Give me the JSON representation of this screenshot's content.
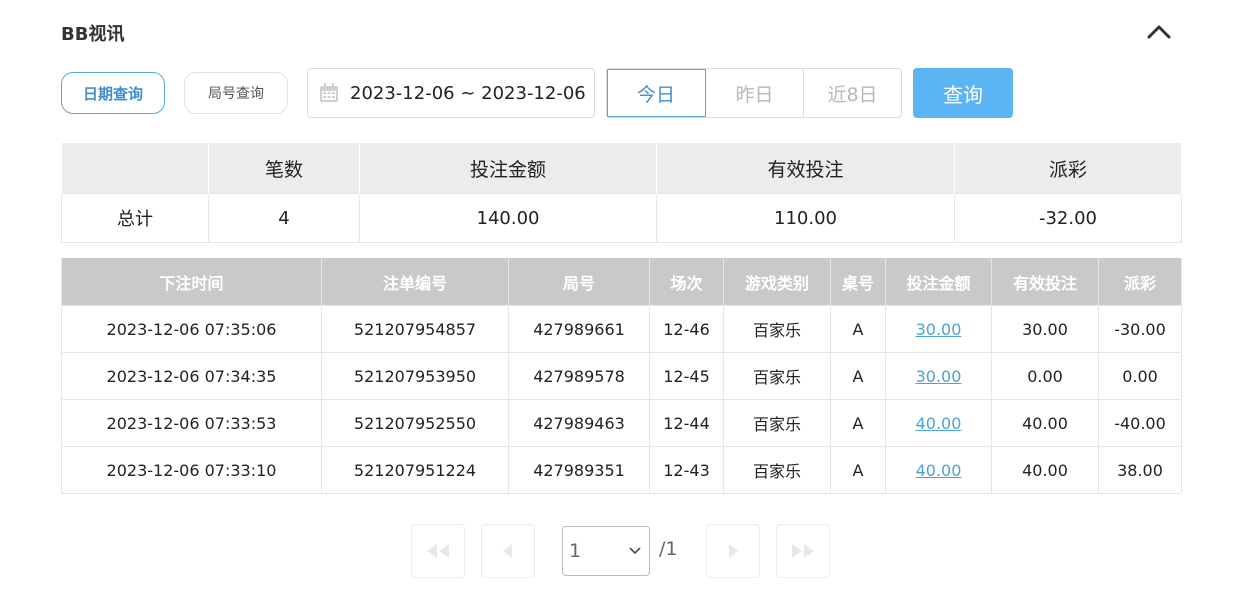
{
  "header": {
    "title": "BB视讯"
  },
  "query_modes": {
    "date_query": "日期查询",
    "game_query": "局号查询"
  },
  "date_range": {
    "value": "2023-12-06 ~ 2023-12-06"
  },
  "quick_ranges": [
    {
      "label": "今日",
      "active": true
    },
    {
      "label": "昨日",
      "active": false
    },
    {
      "label": "近8日",
      "active": false
    }
  ],
  "query_button": "查询",
  "summary": {
    "headers": [
      "",
      "笔数",
      "投注金额",
      "有效投注",
      "派彩"
    ],
    "row": {
      "label": "总计",
      "count": "4",
      "bet_amount": "140.00",
      "valid_bet": "110.00",
      "payout": "-32.00"
    }
  },
  "detail": {
    "headers": [
      "下注时间",
      "注单编号",
      "局号",
      "场次",
      "游戏类别",
      "桌号",
      "投注金额",
      "有效投注",
      "派彩"
    ],
    "rows": [
      {
        "time": "2023-12-06 07:35:06",
        "bet_id": "521207954857",
        "round_id": "427989661",
        "session": "12-46",
        "game_type": "百家乐",
        "table": "A",
        "bet_amount": "30.00",
        "valid_bet": "30.00",
        "payout": "-30.00"
      },
      {
        "time": "2023-12-06 07:34:35",
        "bet_id": "521207953950",
        "round_id": "427989578",
        "session": "12-45",
        "game_type": "百家乐",
        "table": "A",
        "bet_amount": "30.00",
        "valid_bet": "0.00",
        "payout": "0.00"
      },
      {
        "time": "2023-12-06 07:33:53",
        "bet_id": "521207952550",
        "round_id": "427989463",
        "session": "12-44",
        "game_type": "百家乐",
        "table": "A",
        "bet_amount": "40.00",
        "valid_bet": "40.00",
        "payout": "-40.00"
      },
      {
        "time": "2023-12-06 07:33:10",
        "bet_id": "521207951224",
        "round_id": "427989351",
        "session": "12-43",
        "game_type": "百家乐",
        "table": "A",
        "bet_amount": "40.00",
        "valid_bet": "40.00",
        "payout": "38.00"
      }
    ]
  },
  "pagination": {
    "current_page": "1",
    "total_pages": "/1"
  },
  "colors": {
    "accent": "#5bb5f5",
    "negative": "#e0404a",
    "link": "#4aa3d6"
  }
}
